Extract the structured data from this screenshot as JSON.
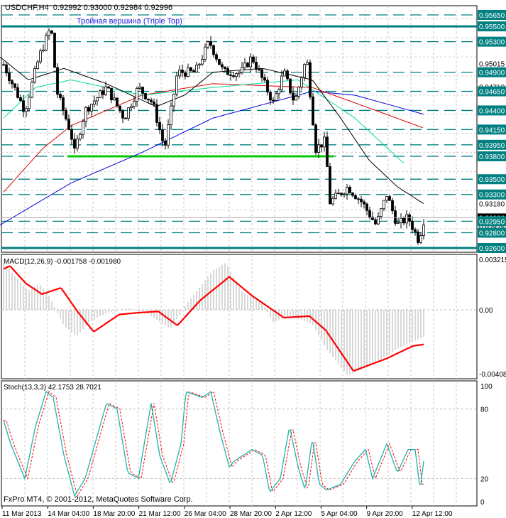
{
  "header": {
    "symbol": "USDCHF,H4",
    "ohlc": "0.92992 0.93000 0.92984 0.92996"
  },
  "annotation": "Тройная вершина (Triple Top)",
  "copyright": "FxPro MT4, © 2001-2012, MetaQuotes Software Corp.",
  "colors": {
    "level": "#008080",
    "support": "#00cc00",
    "ma_blue": "#0000dd",
    "ma_red": "#dd0000",
    "ma_green": "#00dd99",
    "ma_black": "#000000",
    "macd_hist": "#b0b0b0",
    "signal": "#ff0000",
    "stoch_main": "#20b2aa",
    "stoch_signal": "#ff0000"
  },
  "chart_data": [
    {
      "type": "candlestick",
      "title": "USDCHF,H4",
      "ylim": [
        0.9255,
        0.9575
      ],
      "close_path": [
        [
          5,
          0.95
        ],
        [
          20,
          0.947
        ],
        [
          35,
          0.944
        ],
        [
          55,
          0.951
        ],
        [
          72,
          0.955
        ],
        [
          80,
          0.9465
        ],
        [
          100,
          0.941
        ],
        [
          105,
          0.9385
        ],
        [
          120,
          0.944
        ],
        [
          150,
          0.947
        ],
        [
          175,
          0.943
        ],
        [
          195,
          0.947
        ],
        [
          215,
          0.945
        ],
        [
          232,
          0.939
        ],
        [
          250,
          0.949
        ],
        [
          275,
          0.949
        ],
        [
          295,
          0.953
        ],
        [
          315,
          0.949
        ],
        [
          340,
          0.949
        ],
        [
          355,
          0.951
        ],
        [
          370,
          0.948
        ],
        [
          385,
          0.945
        ],
        [
          400,
          0.949
        ],
        [
          415,
          0.945
        ],
        [
          432,
          0.951
        ],
        [
          445,
          0.939
        ],
        [
          458,
          0.94
        ],
        [
          465,
          0.932
        ],
        [
          490,
          0.934
        ],
        [
          510,
          0.932
        ],
        [
          530,
          0.929
        ],
        [
          545,
          0.933
        ],
        [
          560,
          0.929
        ],
        [
          575,
          0.93
        ],
        [
          590,
          0.927
        ],
        [
          598,
          0.92996
        ]
      ],
      "moving_averages": [
        {
          "color": "ma_blue",
          "points": [
            [
              0,
              0.929
            ],
            [
              100,
              0.9345
            ],
            [
              200,
              0.9385
            ],
            [
              300,
              0.943
            ],
            [
              400,
              0.9455
            ],
            [
              440,
              0.9465
            ],
            [
              500,
              0.946
            ],
            [
              597,
              0.9435
            ]
          ]
        },
        {
          "color": "ma_red",
          "points": [
            [
              5,
              0.9333
            ],
            [
              60,
              0.939
            ],
            [
              100,
              0.942
            ],
            [
              200,
              0.946
            ],
            [
              300,
              0.9475
            ],
            [
              440,
              0.947
            ],
            [
              500,
              0.945
            ],
            [
              597,
              0.9417
            ]
          ]
        },
        {
          "color": "ma_green",
          "points": [
            [
              5,
              0.943
            ],
            [
              50,
              0.947
            ],
            [
              100,
              0.948
            ],
            [
              200,
              0.946
            ],
            [
              300,
              0.947
            ],
            [
              420,
              0.948
            ],
            [
              500,
              0.943
            ],
            [
              570,
              0.937
            ]
          ]
        },
        {
          "color": "ma_black",
          "points": [
            [
              0,
              0.951
            ],
            [
              40,
              0.948
            ],
            [
              90,
              0.9495
            ],
            [
              150,
              0.9475
            ],
            [
              220,
              0.9445
            ],
            [
              260,
              0.946
            ],
            [
              300,
              0.949
            ],
            [
              370,
              0.9495
            ],
            [
              440,
              0.948
            ],
            [
              480,
              0.943
            ],
            [
              520,
              0.9375
            ],
            [
              560,
              0.934
            ],
            [
              597,
              0.9318
            ]
          ]
        }
      ],
      "dashed_levels": [
        0.9565,
        0.953,
        0.949,
        0.9465,
        0.944,
        0.9415,
        0.9395,
        0.938,
        0.935,
        0.933,
        0.9295,
        0.928
      ],
      "solid_levels": [
        0.955,
        0.926
      ],
      "support_line": {
        "price": 0.938,
        "from": 95,
        "to": 470
      },
      "level_labels": [
        "0.95650",
        "0.95500",
        "0.95300",
        "0.94900",
        "0.94650",
        "0.94400",
        "0.94150",
        "0.93950",
        "0.93800",
        "0.93500",
        "0.93300",
        "0.92950",
        "0.92800",
        "0.92600"
      ],
      "plain_labels": [
        [
          "0.95015",
          0.95015
        ],
        [
          "0.94710",
          0.9471
        ],
        [
          "0.93180",
          0.9318
        ],
        [
          "0.92875",
          0.92875
        ]
      ],
      "current_price": {
        "label": "0.92996",
        "value": 0.92996
      }
    },
    {
      "type": "macd",
      "title": "MACD(12,26,9) -0.001758 -0.001980",
      "ylim": [
        -0.00408,
        0.003215
      ],
      "tick_labels": [
        "0.003215",
        "0.00",
        "-0.00408"
      ],
      "histogram": [
        [
          5,
          0.003
        ],
        [
          20,
          0.0022
        ],
        [
          40,
          0.0012
        ],
        [
          55,
          0.0017
        ],
        [
          70,
          0.0008
        ],
        [
          90,
          -0.001
        ],
        [
          108,
          -0.0017
        ],
        [
          125,
          -0.0008
        ],
        [
          150,
          -0.0002
        ],
        [
          180,
          0.0001
        ],
        [
          210,
          -0.0003
        ],
        [
          240,
          -0.0012
        ],
        [
          265,
          0.0005
        ],
        [
          300,
          0.0025
        ],
        [
          318,
          0.003
        ],
        [
          340,
          0.0012
        ],
        [
          370,
          0.0004
        ],
        [
          385,
          -0.0008
        ],
        [
          410,
          -0.0004
        ],
        [
          440,
          -0.0009
        ],
        [
          460,
          -0.0025
        ],
        [
          490,
          -0.0042
        ],
        [
          520,
          -0.0036
        ],
        [
          560,
          -0.0025
        ],
        [
          598,
          -0.0017
        ]
      ],
      "signal": [
        [
          5,
          0.0026
        ],
        [
          14,
          0.0028
        ],
        [
          36,
          0.0017
        ],
        [
          59,
          0.001
        ],
        [
          86,
          0.0014
        ],
        [
          109,
          -0.0001
        ],
        [
          132,
          -0.0014
        ],
        [
          168,
          -0.0003
        ],
        [
          191,
          -0.0002
        ],
        [
          223,
          -0.0001
        ],
        [
          250,
          -0.001
        ],
        [
          282,
          0.0006
        ],
        [
          323,
          0.0021
        ],
        [
          355,
          0.0009
        ],
        [
          400,
          -0.0005
        ],
        [
          436,
          -0.0004
        ],
        [
          459,
          -0.0013
        ],
        [
          498,
          -0.0039
        ],
        [
          545,
          -0.0031
        ],
        [
          582,
          -0.0023
        ],
        [
          598,
          -0.0022
        ]
      ]
    },
    {
      "type": "stochastic",
      "title": "Stoch(13,3,3) 42.1753 28.7021",
      "ylim": [
        0,
        100
      ],
      "tick_labels": [
        "100",
        "80",
        "20",
        "0"
      ],
      "main": [
        [
          5,
          70
        ],
        [
          15,
          50
        ],
        [
          35,
          20
        ],
        [
          50,
          65
        ],
        [
          65,
          95
        ],
        [
          75,
          90
        ],
        [
          90,
          40
        ],
        [
          105,
          5
        ],
        [
          120,
          20
        ],
        [
          150,
          85
        ],
        [
          165,
          80
        ],
        [
          180,
          25
        ],
        [
          195,
          20
        ],
        [
          213,
          85
        ],
        [
          225,
          40
        ],
        [
          240,
          15
        ],
        [
          255,
          50
        ],
        [
          262,
          95
        ],
        [
          285,
          90
        ],
        [
          297,
          95
        ],
        [
          310,
          60
        ],
        [
          323,
          30
        ],
        [
          330,
          35
        ],
        [
          355,
          45
        ],
        [
          370,
          40
        ],
        [
          380,
          8
        ],
        [
          395,
          20
        ],
        [
          408,
          65
        ],
        [
          420,
          30
        ],
        [
          430,
          10
        ],
        [
          440,
          55
        ],
        [
          450,
          15
        ],
        [
          460,
          10
        ],
        [
          480,
          15
        ],
        [
          500,
          35
        ],
        [
          515,
          45
        ],
        [
          525,
          20
        ],
        [
          545,
          50
        ],
        [
          560,
          25
        ],
        [
          575,
          45
        ],
        [
          585,
          45
        ],
        [
          592,
          10
        ],
        [
          598,
          40
        ]
      ]
    }
  ],
  "time_axis": [
    "11 Mar 2013",
    "14 Mar 04:00",
    "18 Mar 20:00",
    "21 Mar 12:00",
    "26 Mar 04:00",
    "28 Mar 20:00",
    "2 Apr 12:00",
    "5 Apr 04:00",
    "9 Apr 20:00",
    "12 Apr 12:00"
  ]
}
